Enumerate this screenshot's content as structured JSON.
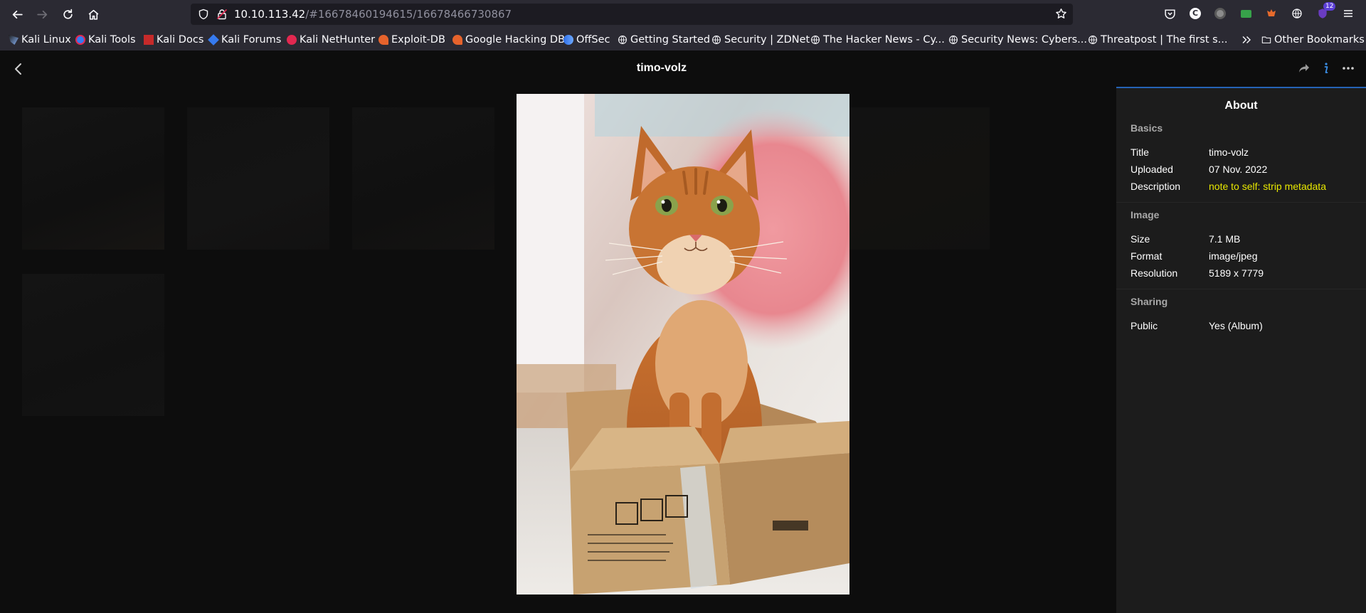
{
  "browser": {
    "url_host": "10.10.113.42",
    "url_path": "/#16678460194615/16678466730867",
    "badge_count": "12",
    "bookmarks": [
      "Kali Linux",
      "Kali Tools",
      "Kali Docs",
      "Kali Forums",
      "Kali NetHunter",
      "Exploit-DB",
      "Google Hacking DB",
      "OffSec",
      "Getting Started",
      "Security | ZDNet",
      "The Hacker News - Cy...",
      "Security News: Cybers...",
      "Threatpost | The first s...",
      "Other Bookmarks"
    ]
  },
  "viewer": {
    "title": "timo-volz"
  },
  "sidebar": {
    "heading": "About",
    "basics": {
      "section": "Basics",
      "title_label": "Title",
      "title_value": "timo-volz",
      "uploaded_label": "Uploaded",
      "uploaded_value": "07 Nov. 2022",
      "description_label": "Description",
      "description_value": "note to self: strip metadata",
      "description_color": "#e8e800"
    },
    "image": {
      "section": "Image",
      "size_label": "Size",
      "size_value": "7.1 MB",
      "format_label": "Format",
      "format_value": "image/jpeg",
      "resolution_label": "Resolution",
      "resolution_value": "5189 x 7779"
    },
    "sharing": {
      "section": "Sharing",
      "public_label": "Public",
      "public_value": "Yes (Album)"
    }
  },
  "colors": {
    "chrome_bg": "#2b2a33",
    "urlbar_bg": "#1c1b22",
    "page_bg": "#0d0d0d",
    "sidebar_bg": "#1c1c1c",
    "accent": "#2563b6",
    "info_active": "#3a8ee6"
  }
}
